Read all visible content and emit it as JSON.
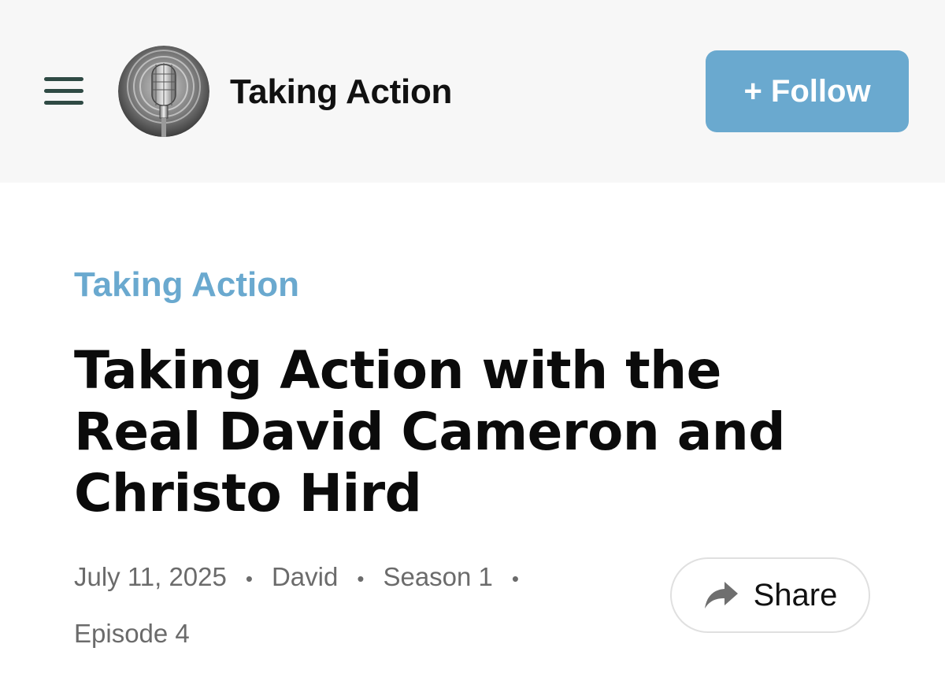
{
  "header": {
    "podcast_name": "Taking Action",
    "follow_label": "+ Follow"
  },
  "episode": {
    "category": "Taking Action",
    "title": "Taking Action with the Real David Cameron and Christo Hird",
    "date": "July 11, 2025",
    "author": "David",
    "season": "Season 1",
    "episode_number": "Episode 4",
    "separator": "•"
  },
  "share": {
    "label": "Share"
  },
  "colors": {
    "accent": "#6aa9cf",
    "header_bg": "#f7f7f7",
    "menu_icon": "#2f4a44"
  },
  "icons": [
    "hamburger-menu-icon",
    "microphone-logo-icon",
    "share-arrow-icon"
  ]
}
